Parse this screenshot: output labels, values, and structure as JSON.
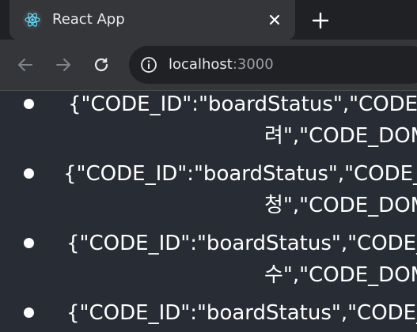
{
  "tab": {
    "title": "React App",
    "favicon": "react-logo-icon",
    "close_icon": "close-icon"
  },
  "new_tab_icon": "plus-icon",
  "toolbar": {
    "back_icon": "back-arrow-icon",
    "forward_icon": "forward-arrow-icon",
    "reload_icon": "reload-icon",
    "info_icon": "info-icon",
    "url_host": "localhost",
    "url_port": ":3000"
  },
  "page": {
    "items": [
      {
        "line1": "{\"CODE_ID\":\"boardStatus\",\"CODE_ID\":",
        "line2": "려\",\"CODE_DOM\":"
      },
      {
        "line1": "{\"CODE_ID\":\"boardStatus\",\"CODE_ID\":",
        "line2": "청\",\"CODE_DOM\":"
      },
      {
        "line1": "{\"CODE_ID\":\"boardStatus\",\"CODE_ID\":",
        "line2": "수\",\"CODE_DOM\":"
      },
      {
        "line1": "{\"CODE_ID\":\"boardStatus\",\"CODE_ID\":",
        "line2": ""
      }
    ]
  },
  "colors": {
    "tabstrip_bg": "#202124",
    "tab_bg": "#35363a",
    "content_bg": "#282c34",
    "text": "#ffffff",
    "react_blue": "#61dafb"
  }
}
